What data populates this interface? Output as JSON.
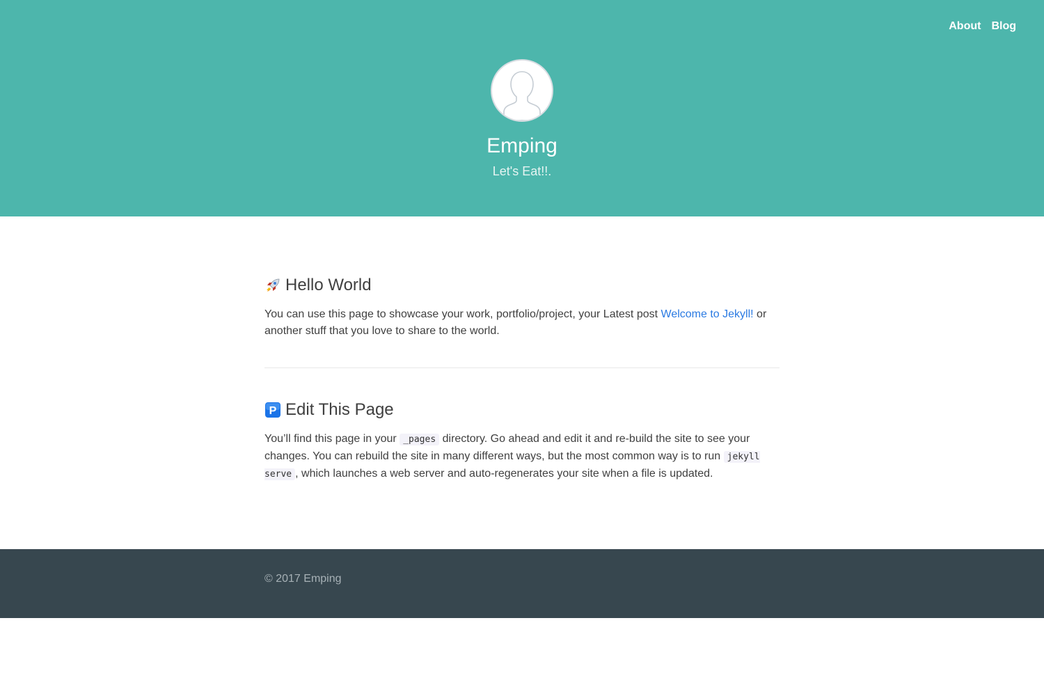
{
  "nav": {
    "items": [
      "About",
      "Blog"
    ]
  },
  "header": {
    "avatar_icon": "user-silhouette-icon",
    "title": "Emping",
    "tagline": "Let's Eat!!."
  },
  "sections": [
    {
      "emoji": "rocket-icon",
      "heading": "Hello World",
      "text_before_link": "You can use this page to showcase your work, portfolio/project, your Latest post ",
      "link_text": "Welcome to Jekyll!",
      "text_after_link": " or another stuff that you love to share to the world."
    },
    {
      "emoji": "p-button-icon",
      "heading": "Edit This Page",
      "text_1": "You’ll find this page in your ",
      "code_1": "_pages",
      "text_2": " directory. Go ahead and edit it and re-build the site to see your changes. You can rebuild the site in many different ways, but the most common way is to run ",
      "code_2": "jekyll serve",
      "text_3": ", which launches a web server and auto-regenerates your site when a file is updated."
    }
  ],
  "footer": {
    "copyright": "© 2017 Emping"
  },
  "colors": {
    "header_bg": "#4db6ac",
    "footer_bg": "#37474f",
    "link": "#2a7ae2"
  }
}
